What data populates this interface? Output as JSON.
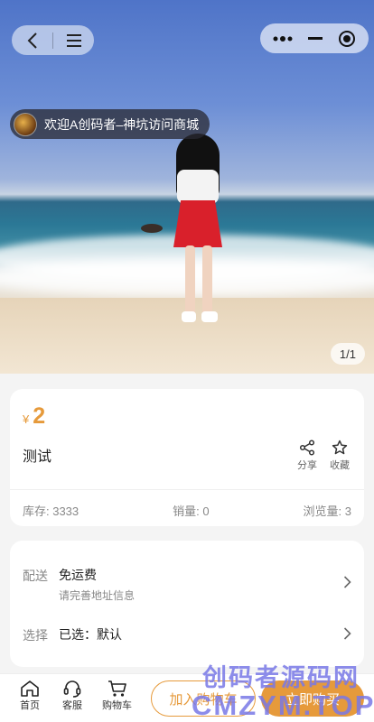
{
  "hero": {
    "pager": "1/1",
    "notice_text": "欢迎A创码者–神坑访问商城"
  },
  "nav": {
    "back_icon": "chevron-left-icon",
    "menu_icon": "menu-icon",
    "more_icon": "more-dots-icon",
    "minimize_icon": "minimize-icon",
    "close_icon": "target-close-icon"
  },
  "product": {
    "currency": "¥",
    "price": "2",
    "title": "测试",
    "share_label": "分享",
    "favorite_label": "收藏",
    "stock": "库存: 3333",
    "sales": "销量: 0",
    "views": "浏览量: 3"
  },
  "shipping": {
    "ship_label": "配送",
    "ship_value": "免运费",
    "ship_sub": "请完善地址信息",
    "select_label": "选择",
    "select_value": "已选：默认"
  },
  "bottom": {
    "home_label": "首页",
    "service_label": "客服",
    "cart_label": "购物车",
    "add_cart_label": "加入购物车",
    "buy_label": "立即购买"
  },
  "watermark": {
    "line1": "创码者源码网",
    "line2": "CMZYM.TOP"
  },
  "colors": {
    "accent": "#e69a3b"
  }
}
